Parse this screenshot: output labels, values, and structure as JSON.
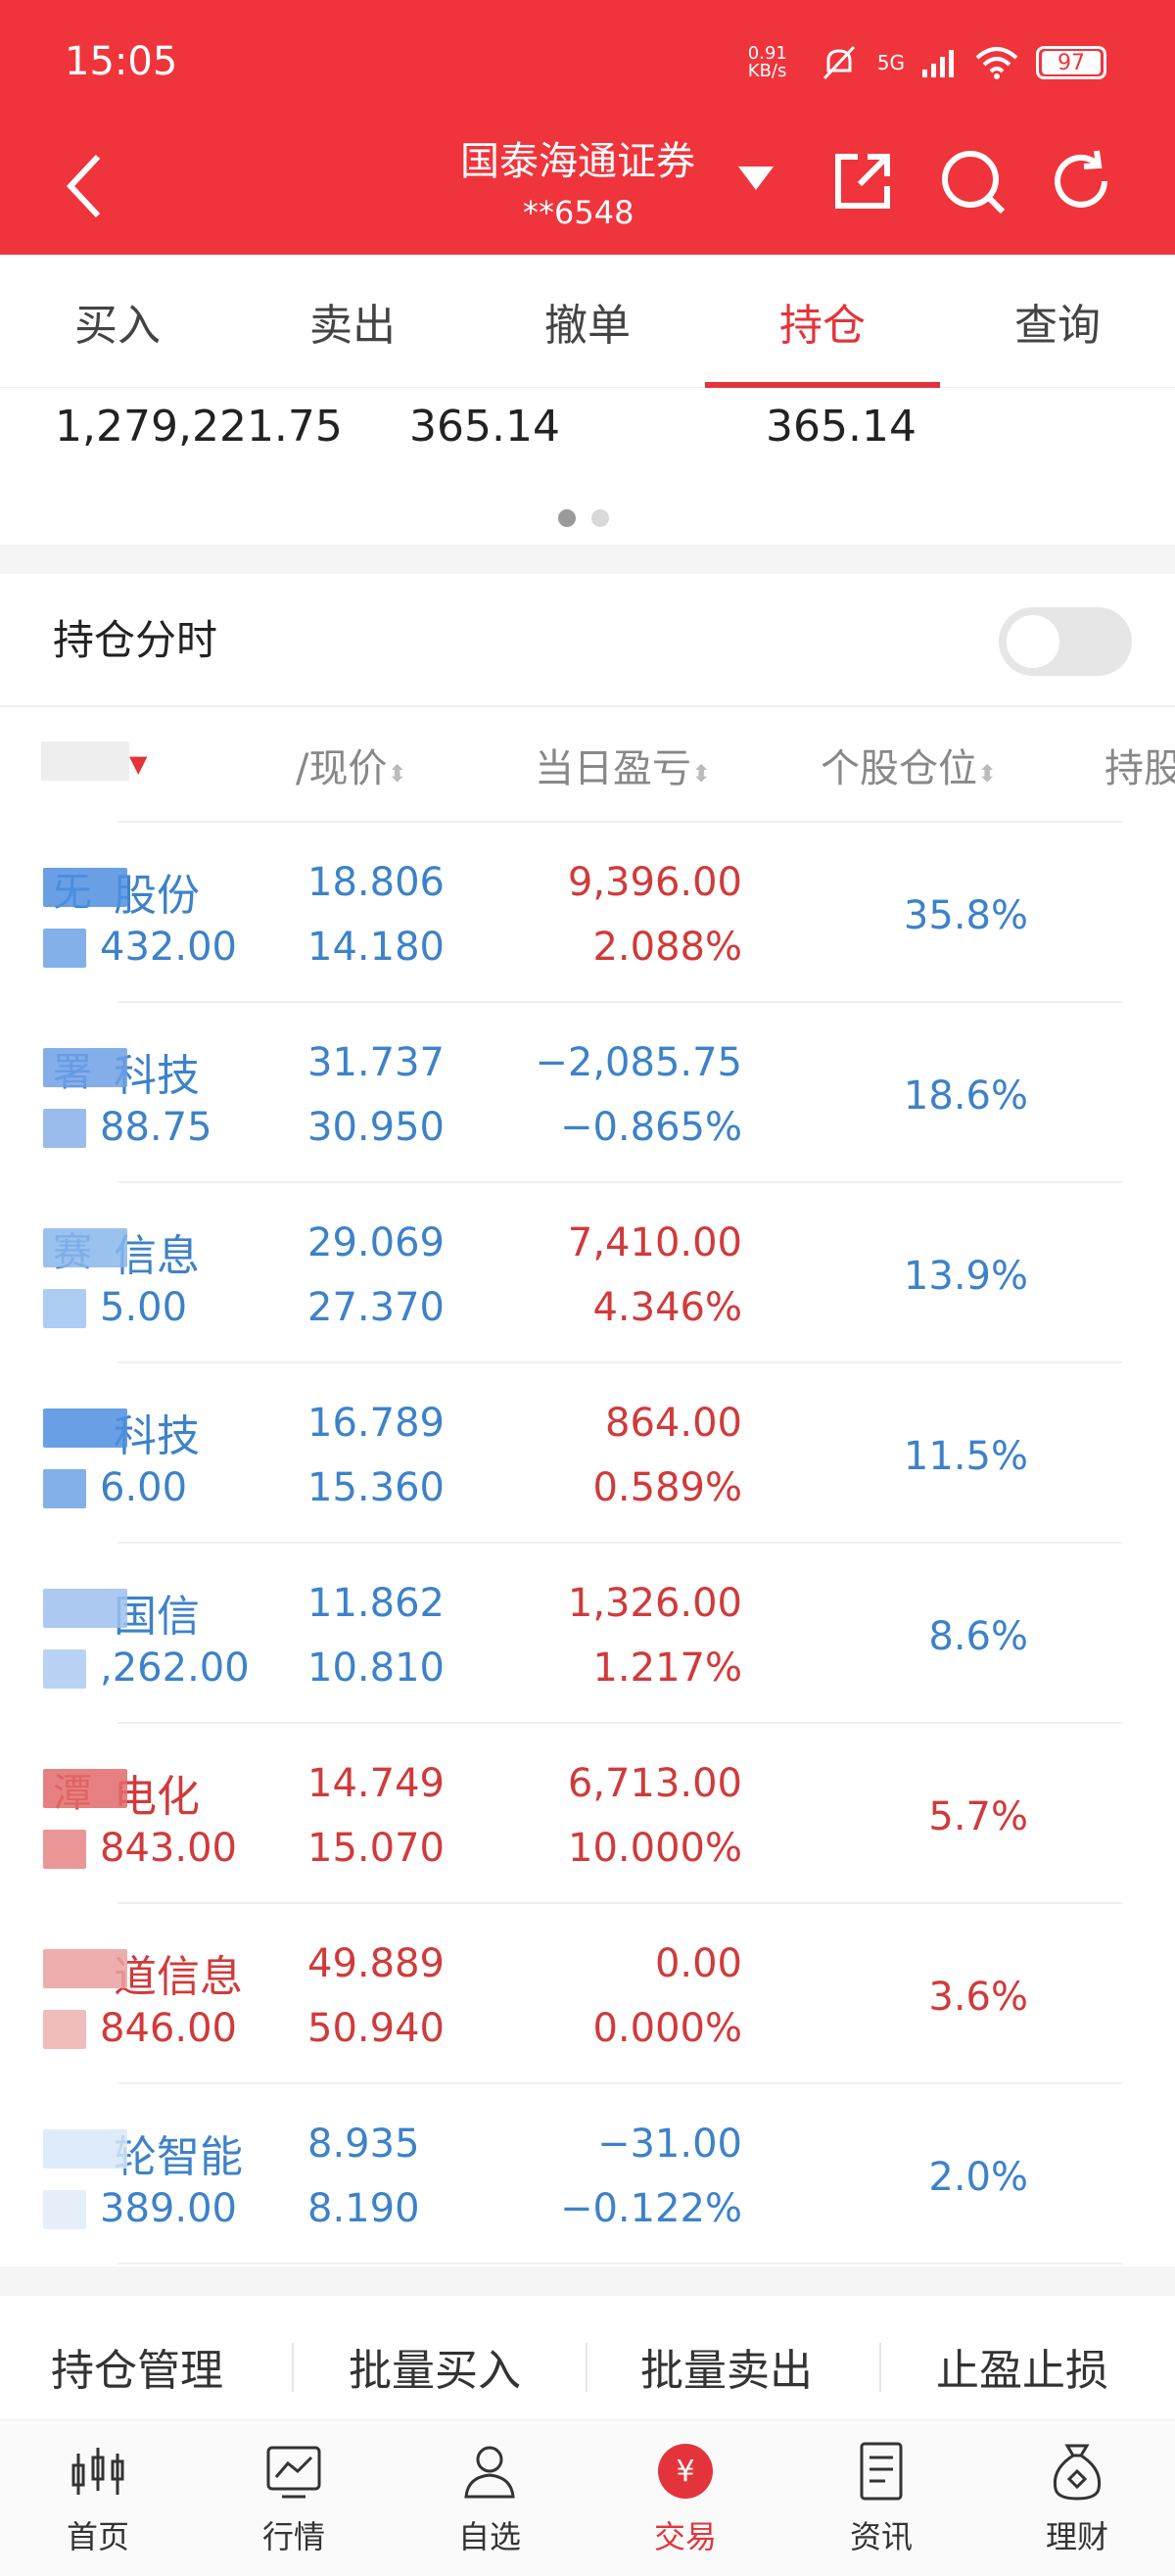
{
  "status_bar": {
    "time": "15:05",
    "net_speed": "0.91 KB/s",
    "signal": "5G",
    "battery": "97"
  },
  "header": {
    "broker": "国泰海通证券",
    "account": "**6548"
  },
  "tabs": [
    "买入",
    "卖出",
    "撤单",
    "持仓",
    "查询"
  ],
  "active_tab": "持仓",
  "summary": {
    "total_assets": "1,279,221.75",
    "value_2": "365.14",
    "value_3": "365.14"
  },
  "pager": {
    "pages": 2,
    "current": 1
  },
  "timeshare": {
    "label": "持仓分时",
    "enabled": false
  },
  "columns": {
    "name": "/现价",
    "pnl_today": "当日盈亏",
    "position_pct": "个股仓位",
    "holdings": "持股"
  },
  "holdings": [
    {
      "name": "股份",
      "name_prefix": "旡",
      "qty": "432.00",
      "cost": "18.806",
      "price": "14.180",
      "pnl": "9,396.00",
      "pnl_pct": "2.088%",
      "position": "35.8%",
      "pnl_color": "red",
      "name_color": "blue"
    },
    {
      "name": "科技",
      "name_prefix": "署",
      "qty": "88.75",
      "cost": "31.737",
      "price": "30.950",
      "pnl": "−2,085.75",
      "pnl_pct": "−0.865%",
      "position": "18.6%",
      "pnl_color": "blue",
      "name_color": "blue"
    },
    {
      "name": "信息",
      "name_prefix": "赛",
      "qty": "5.00",
      "cost": "29.069",
      "price": "27.370",
      "pnl": "7,410.00",
      "pnl_pct": "4.346%",
      "position": "13.9%",
      "pnl_color": "red",
      "name_color": "blue"
    },
    {
      "name": "科技",
      "name_prefix": "",
      "qty": "6.00",
      "cost": "16.789",
      "price": "15.360",
      "pnl": "864.00",
      "pnl_pct": "0.589%",
      "position": "11.5%",
      "pnl_color": "red",
      "name_color": "blue"
    },
    {
      "name": "国信",
      "name_prefix": "",
      "qty": ",262.00",
      "cost": "11.862",
      "price": "10.810",
      "pnl": "1,326.00",
      "pnl_pct": "1.217%",
      "position": "8.6%",
      "pnl_color": "red",
      "name_color": "blue"
    },
    {
      "name": "电化",
      "name_prefix": "潭",
      "qty": "843.00",
      "cost": "14.749",
      "price": "15.070",
      "pnl": "6,713.00",
      "pnl_pct": "10.000%",
      "position": "5.7%",
      "pnl_color": "red",
      "name_color": "red"
    },
    {
      "name": "道信息",
      "name_prefix": "",
      "qty": "846.00",
      "cost": "49.889",
      "price": "50.940",
      "pnl": "0.00",
      "pnl_pct": "0.000%",
      "position": "3.6%",
      "pnl_color": "red",
      "name_color": "red"
    },
    {
      "name": "轮智能",
      "name_prefix": "",
      "qty": "389.00",
      "cost": "8.935",
      "price": "8.190",
      "pnl": "−31.00",
      "pnl_pct": "−0.122%",
      "position": "2.0%",
      "pnl_color": "blue",
      "name_color": "blue"
    }
  ],
  "actions": [
    "持仓管理",
    "批量买入",
    "批量卖出",
    "止盈止损"
  ],
  "bottom_nav": [
    {
      "label": "首页",
      "icon": "chart-candle-icon"
    },
    {
      "label": "行情",
      "icon": "market-icon"
    },
    {
      "label": "自选",
      "icon": "person-icon"
    },
    {
      "label": "交易",
      "icon": "yuan-circle-icon"
    },
    {
      "label": "资讯",
      "icon": "news-icon"
    },
    {
      "label": "理财",
      "icon": "money-bag-icon"
    }
  ],
  "colors": {
    "brand": "#f0343c",
    "up": "#d13a3a",
    "down": "#3d82c9"
  }
}
